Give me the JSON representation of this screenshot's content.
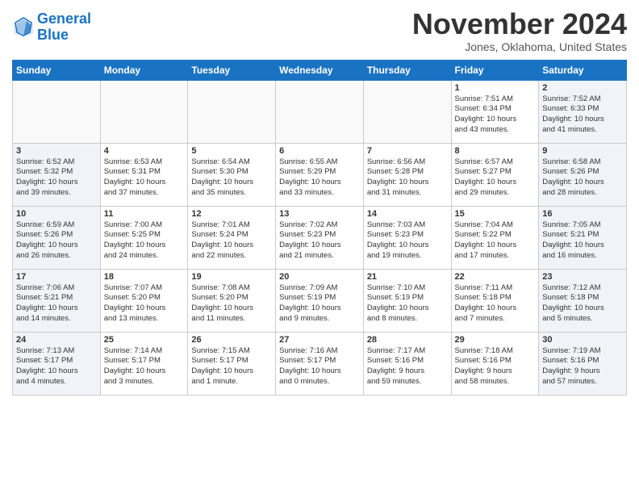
{
  "header": {
    "logo_line1": "General",
    "logo_line2": "Blue",
    "month": "November 2024",
    "location": "Jones, Oklahoma, United States"
  },
  "weekdays": [
    "Sunday",
    "Monday",
    "Tuesday",
    "Wednesday",
    "Thursday",
    "Friday",
    "Saturday"
  ],
  "weeks": [
    [
      {
        "day": "",
        "info": ""
      },
      {
        "day": "",
        "info": ""
      },
      {
        "day": "",
        "info": ""
      },
      {
        "day": "",
        "info": ""
      },
      {
        "day": "",
        "info": ""
      },
      {
        "day": "1",
        "info": "Sunrise: 7:51 AM\nSunset: 6:34 PM\nDaylight: 10 hours\nand 43 minutes."
      },
      {
        "day": "2",
        "info": "Sunrise: 7:52 AM\nSunset: 6:33 PM\nDaylight: 10 hours\nand 41 minutes."
      }
    ],
    [
      {
        "day": "3",
        "info": "Sunrise: 6:52 AM\nSunset: 5:32 PM\nDaylight: 10 hours\nand 39 minutes."
      },
      {
        "day": "4",
        "info": "Sunrise: 6:53 AM\nSunset: 5:31 PM\nDaylight: 10 hours\nand 37 minutes."
      },
      {
        "day": "5",
        "info": "Sunrise: 6:54 AM\nSunset: 5:30 PM\nDaylight: 10 hours\nand 35 minutes."
      },
      {
        "day": "6",
        "info": "Sunrise: 6:55 AM\nSunset: 5:29 PM\nDaylight: 10 hours\nand 33 minutes."
      },
      {
        "day": "7",
        "info": "Sunrise: 6:56 AM\nSunset: 5:28 PM\nDaylight: 10 hours\nand 31 minutes."
      },
      {
        "day": "8",
        "info": "Sunrise: 6:57 AM\nSunset: 5:27 PM\nDaylight: 10 hours\nand 29 minutes."
      },
      {
        "day": "9",
        "info": "Sunrise: 6:58 AM\nSunset: 5:26 PM\nDaylight: 10 hours\nand 28 minutes."
      }
    ],
    [
      {
        "day": "10",
        "info": "Sunrise: 6:59 AM\nSunset: 5:26 PM\nDaylight: 10 hours\nand 26 minutes."
      },
      {
        "day": "11",
        "info": "Sunrise: 7:00 AM\nSunset: 5:25 PM\nDaylight: 10 hours\nand 24 minutes."
      },
      {
        "day": "12",
        "info": "Sunrise: 7:01 AM\nSunset: 5:24 PM\nDaylight: 10 hours\nand 22 minutes."
      },
      {
        "day": "13",
        "info": "Sunrise: 7:02 AM\nSunset: 5:23 PM\nDaylight: 10 hours\nand 21 minutes."
      },
      {
        "day": "14",
        "info": "Sunrise: 7:03 AM\nSunset: 5:23 PM\nDaylight: 10 hours\nand 19 minutes."
      },
      {
        "day": "15",
        "info": "Sunrise: 7:04 AM\nSunset: 5:22 PM\nDaylight: 10 hours\nand 17 minutes."
      },
      {
        "day": "16",
        "info": "Sunrise: 7:05 AM\nSunset: 5:21 PM\nDaylight: 10 hours\nand 16 minutes."
      }
    ],
    [
      {
        "day": "17",
        "info": "Sunrise: 7:06 AM\nSunset: 5:21 PM\nDaylight: 10 hours\nand 14 minutes."
      },
      {
        "day": "18",
        "info": "Sunrise: 7:07 AM\nSunset: 5:20 PM\nDaylight: 10 hours\nand 13 minutes."
      },
      {
        "day": "19",
        "info": "Sunrise: 7:08 AM\nSunset: 5:20 PM\nDaylight: 10 hours\nand 11 minutes."
      },
      {
        "day": "20",
        "info": "Sunrise: 7:09 AM\nSunset: 5:19 PM\nDaylight: 10 hours\nand 9 minutes."
      },
      {
        "day": "21",
        "info": "Sunrise: 7:10 AM\nSunset: 5:19 PM\nDaylight: 10 hours\nand 8 minutes."
      },
      {
        "day": "22",
        "info": "Sunrise: 7:11 AM\nSunset: 5:18 PM\nDaylight: 10 hours\nand 7 minutes."
      },
      {
        "day": "23",
        "info": "Sunrise: 7:12 AM\nSunset: 5:18 PM\nDaylight: 10 hours\nand 5 minutes."
      }
    ],
    [
      {
        "day": "24",
        "info": "Sunrise: 7:13 AM\nSunset: 5:17 PM\nDaylight: 10 hours\nand 4 minutes."
      },
      {
        "day": "25",
        "info": "Sunrise: 7:14 AM\nSunset: 5:17 PM\nDaylight: 10 hours\nand 3 minutes."
      },
      {
        "day": "26",
        "info": "Sunrise: 7:15 AM\nSunset: 5:17 PM\nDaylight: 10 hours\nand 1 minute."
      },
      {
        "day": "27",
        "info": "Sunrise: 7:16 AM\nSunset: 5:17 PM\nDaylight: 10 hours\nand 0 minutes."
      },
      {
        "day": "28",
        "info": "Sunrise: 7:17 AM\nSunset: 5:16 PM\nDaylight: 9 hours\nand 59 minutes."
      },
      {
        "day": "29",
        "info": "Sunrise: 7:18 AM\nSunset: 5:16 PM\nDaylight: 9 hours\nand 58 minutes."
      },
      {
        "day": "30",
        "info": "Sunrise: 7:19 AM\nSunset: 5:16 PM\nDaylight: 9 hours\nand 57 minutes."
      }
    ]
  ]
}
